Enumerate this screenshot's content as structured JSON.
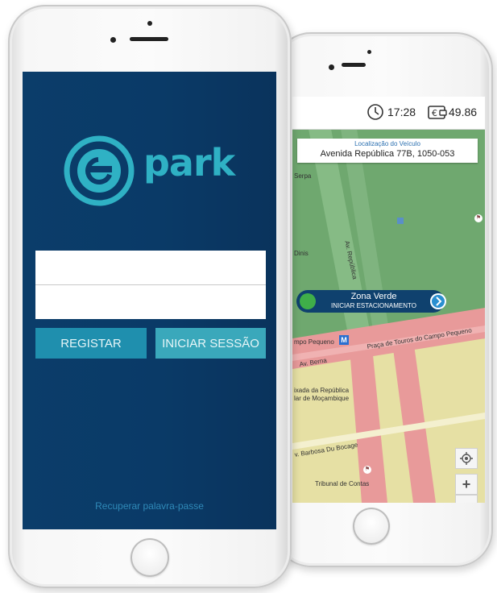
{
  "front_app": {
    "logo_text": "park",
    "username_field": {
      "value": "",
      "placeholder": ""
    },
    "password_field": {
      "value": "",
      "placeholder": ""
    },
    "register_label": "REGISTAR",
    "login_label": "INICIAR SESSÃO",
    "recover_label": "Recuperar palavra-passe"
  },
  "map_app": {
    "status": {
      "time": "17:28",
      "balance": "49.86",
      "clock_icon": "clock-icon",
      "wallet_icon": "wallet-euro-icon"
    },
    "location": {
      "title": "Localização do Veículo",
      "address": "Avenida República 77B, 1050-053"
    },
    "zone": {
      "name": "Zona Verde",
      "action": "INICIAR ESTACIONAMENTO"
    },
    "map_labels": {
      "serpa": "Serpa",
      "av_republica": "Av. República",
      "dinis": "Dinis",
      "campo_pequeno": "mpo Pequeno",
      "metro": "M",
      "praca": "Praça de Touros do Campo Pequeno",
      "av_berna": "Av. Berna",
      "embaixada_1": "ixada da República",
      "embaixada_2": "lar de Moçambique",
      "barbosa": "v. Barbosa Du Bocage",
      "tribunal": "Tribunal de Contas"
    },
    "controls": {
      "locate": "locate-icon",
      "zoom_in": "+",
      "zoom_out": "−"
    }
  },
  "colors": {
    "front_bg": "#0b3d6a",
    "accent_teal": "#2fb1c4",
    "register_btn": "#1f8fae",
    "login_btn": "#3aa8bb",
    "map_green": "#6fa86f",
    "map_red": "#e89a9a",
    "map_yellow": "#e6e0a4",
    "zone_pill": "#0f416e"
  }
}
